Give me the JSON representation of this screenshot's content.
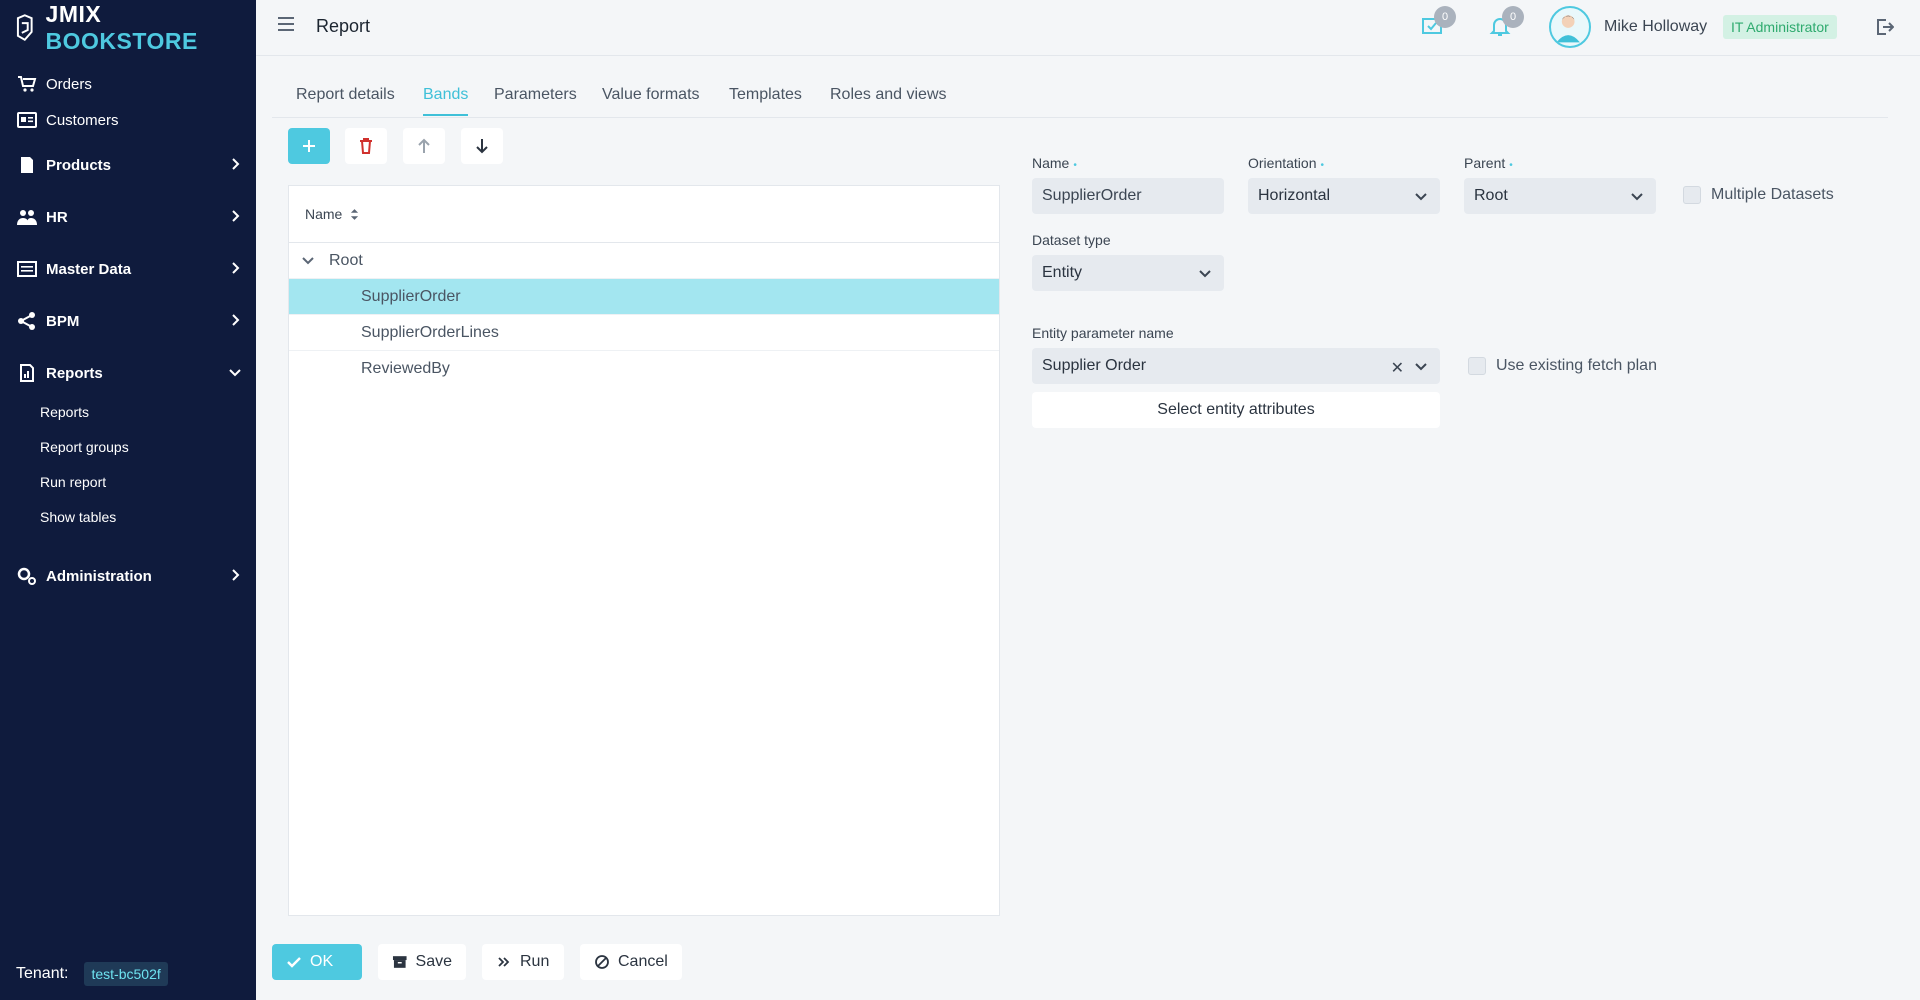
{
  "app": {
    "brand_part1": "JMIX",
    "brand_part2": "BOOKSTORE",
    "brand_color": "#4ec9e0",
    "sidebar_bg": "#0f1b3d"
  },
  "sidebar": {
    "items": [
      {
        "label": "Orders",
        "icon": "cart-icon"
      },
      {
        "label": "Customers",
        "icon": "id-card-icon"
      },
      {
        "label": "Products",
        "icon": "document-icon"
      },
      {
        "label": "HR",
        "icon": "users-icon"
      },
      {
        "label": "Master Data",
        "icon": "table-icon"
      },
      {
        "label": "BPM",
        "icon": "share-icon"
      },
      {
        "label": "Reports",
        "icon": "report-icon"
      },
      {
        "label": "Administration",
        "icon": "gears-icon"
      }
    ],
    "reports_sub": [
      "Reports",
      "Report groups",
      "Run report",
      "Show tables"
    ],
    "tenant_label": "Tenant:",
    "tenant_value": "test-bc502f"
  },
  "header": {
    "title": "Report",
    "tasks_count": "0",
    "notifications_count": "0",
    "user_name": "Mike Holloway",
    "role": "IT Administrator"
  },
  "tabs": [
    "Report details",
    "Bands",
    "Parameters",
    "Value formats",
    "Templates",
    "Roles and views"
  ],
  "active_tab": "Bands",
  "tree": {
    "column": "Name",
    "root": "Root",
    "children": [
      "SupplierOrder",
      "SupplierOrderLines",
      "ReviewedBy"
    ],
    "selected": "SupplierOrder"
  },
  "form": {
    "name_label": "Name",
    "name_value": "SupplierOrder",
    "orientation_label": "Orientation",
    "orientation_value": "Horizontal",
    "parent_label": "Parent",
    "parent_value": "Root",
    "multiple_datasets": "Multiple Datasets",
    "dataset_type_label": "Dataset type",
    "dataset_type_value": "Entity",
    "entity_param_label": "Entity parameter name",
    "entity_param_value": "Supplier Order",
    "use_fetch_plan": "Use existing fetch plan",
    "select_attrs": "Select entity attributes",
    "required_mark": "•"
  },
  "footer": {
    "ok": "OK",
    "save": "Save",
    "run": "Run",
    "cancel": "Cancel"
  }
}
